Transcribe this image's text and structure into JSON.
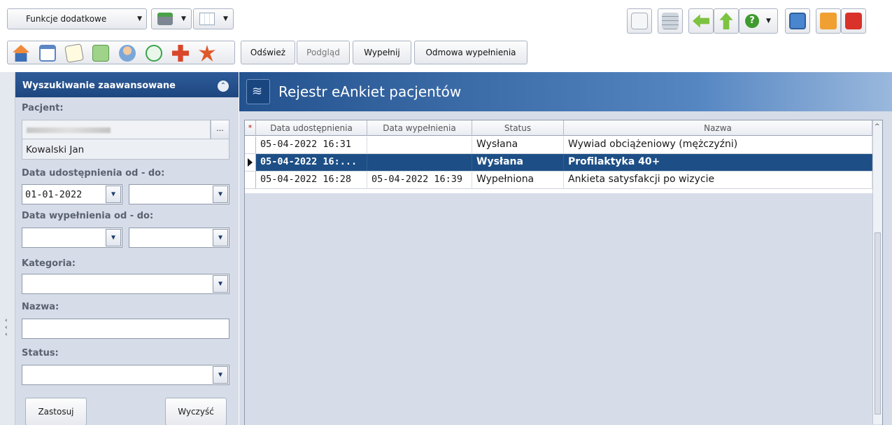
{
  "toolbar": {
    "functions_label": "Funkcje dodatkowe",
    "actions": {
      "refresh": "Odśwież",
      "preview": "Podgląd",
      "fill": "Wypełnij",
      "refuse": "Odmowa wypełnienia"
    },
    "left_icons": [
      "home-icon",
      "calendar-icon",
      "notes-icon",
      "documents-icon",
      "patients-icon",
      "clock-icon",
      "medical-icon",
      "snowflake-icon"
    ],
    "right_icons": [
      "mail-icon",
      "network-icon",
      "back-arrow-icon",
      "up-arrow-icon",
      "help-icon",
      "monitor-icon",
      "lock-icon",
      "power-icon"
    ]
  },
  "search_panel": {
    "title": "Wyszukiwanie zaawansowane",
    "patient_label": "Pacjent:",
    "patient_name": "Kowalski Jan",
    "ellipsis": "...",
    "shared_label": "Data udostępnienia od - do:",
    "shared_from": "01-01-2022",
    "shared_to": "",
    "filled_label": "Data wypełnienia od - do:",
    "filled_from": "",
    "filled_to": "",
    "category_label": "Kategoria:",
    "category_value": "",
    "name_label": "Nazwa:",
    "name_value": "",
    "status_label": "Status:",
    "status_value": "",
    "apply_button": "Zastosuj",
    "clear_button": "Wyczyść"
  },
  "main": {
    "title": "Rejestr eAnkiet pacjentów",
    "columns": [
      "Data udostępnienia",
      "Data wypełnienia",
      "Status",
      "Nazwa"
    ],
    "rows": [
      {
        "shared": "05-04-2022 16:31",
        "filled": "",
        "status": "Wysłana",
        "name": "Wywiad obciążeniowy (mężczyźni)"
      },
      {
        "shared": "05-04-2022 16:...",
        "filled": "",
        "status": "Wysłana",
        "name": "Profilaktyka 40+"
      },
      {
        "shared": "05-04-2022 16:28",
        "filled": "05-04-2022 16:39",
        "status": "Wypełniona",
        "name": "Ankieta satysfakcji po wizycie"
      }
    ],
    "selected_row": 1
  },
  "colors": {
    "header_blue": "#23528e",
    "selection": "#1d4f86",
    "panel_bg": "#d6dce8"
  }
}
